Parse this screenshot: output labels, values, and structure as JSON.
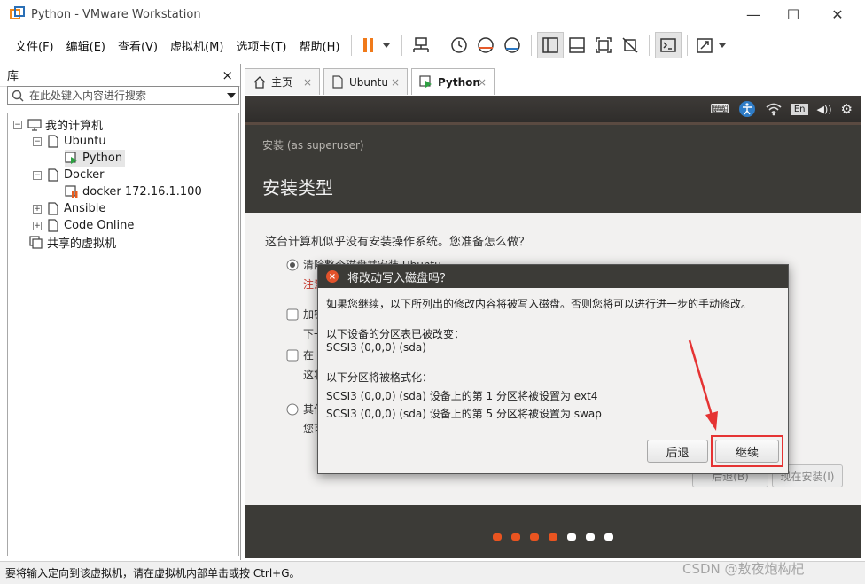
{
  "window": {
    "title": "Python - VMware Workstation",
    "minimize": "—",
    "maximize": "☐",
    "close": "✕"
  },
  "menu": [
    "文件(F)",
    "编辑(E)",
    "查看(V)",
    "虚拟机(M)",
    "选项卡(T)",
    "帮助(H)"
  ],
  "library": {
    "title": "库",
    "close": "×",
    "search_placeholder": "在此处键入内容进行搜索",
    "tree": [
      {
        "label": "我的计算机",
        "expander": "−"
      },
      {
        "label": "Ubuntu",
        "expander": "−"
      },
      {
        "label": "Python"
      },
      {
        "label": "Docker",
        "expander": "−"
      },
      {
        "label": "docker  172.16.1.100"
      },
      {
        "label": "Ansible",
        "expander": "+"
      },
      {
        "label": "Code Online",
        "expander": "+"
      },
      {
        "label": "共享的虚拟机"
      }
    ]
  },
  "tabs": [
    {
      "label": "主页",
      "close": "×"
    },
    {
      "label": "Ubuntu",
      "close": "×"
    },
    {
      "label": "Python",
      "close": "×"
    }
  ],
  "vm": {
    "topbar": {
      "keyboard": "⌨",
      "lang": "En",
      "volume": "◀))",
      "gear": "⚙"
    },
    "superuser": "安装 (as superuser)",
    "title": "安装类型",
    "question": "这台计算机似乎没有安装操作系统。您准备怎么做？",
    "options": [
      {
        "label": "清除整个磁盘并安装 Ubuntu",
        "sub": "注意"
      },
      {
        "label": "加密",
        "sub": "下一"
      },
      {
        "label": "在 U",
        "sub": "这将"
      },
      {
        "label": "其他",
        "sub": "您可"
      }
    ],
    "back_button": "后退(B)",
    "install_now_button": "现在安装(I)"
  },
  "dialog": {
    "title": "将改动写入磁盘吗？",
    "close": "×",
    "message": "如果您继续，以下所列出的修改内容将被写入磁盘。否则您将可以进行进一步的手动修改。",
    "partition_header": "以下设备的分区表已被改变：",
    "partition_device": "SCSI3 (0,0,0) (sda)",
    "format_header": "以下分区将被格式化：",
    "format_lines": [
      "SCSI3 (0,0,0) (sda) 设备上的第 1 分区将被设置为 ext4",
      "SCSI3 (0,0,0) (sda) 设备上的第 5 分区将被设置为 swap"
    ],
    "back": "后退",
    "continue": "继续"
  },
  "progress": {
    "completed_steps": 4,
    "total_steps": 7,
    "done_color": "#e95420",
    "todo_color": "#ffffff"
  },
  "status": "要将输入定向到该虚拟机，请在虚拟机内部单击或按 Ctrl+G。",
  "watermark": "CSDN @敖夜炮构杞"
}
